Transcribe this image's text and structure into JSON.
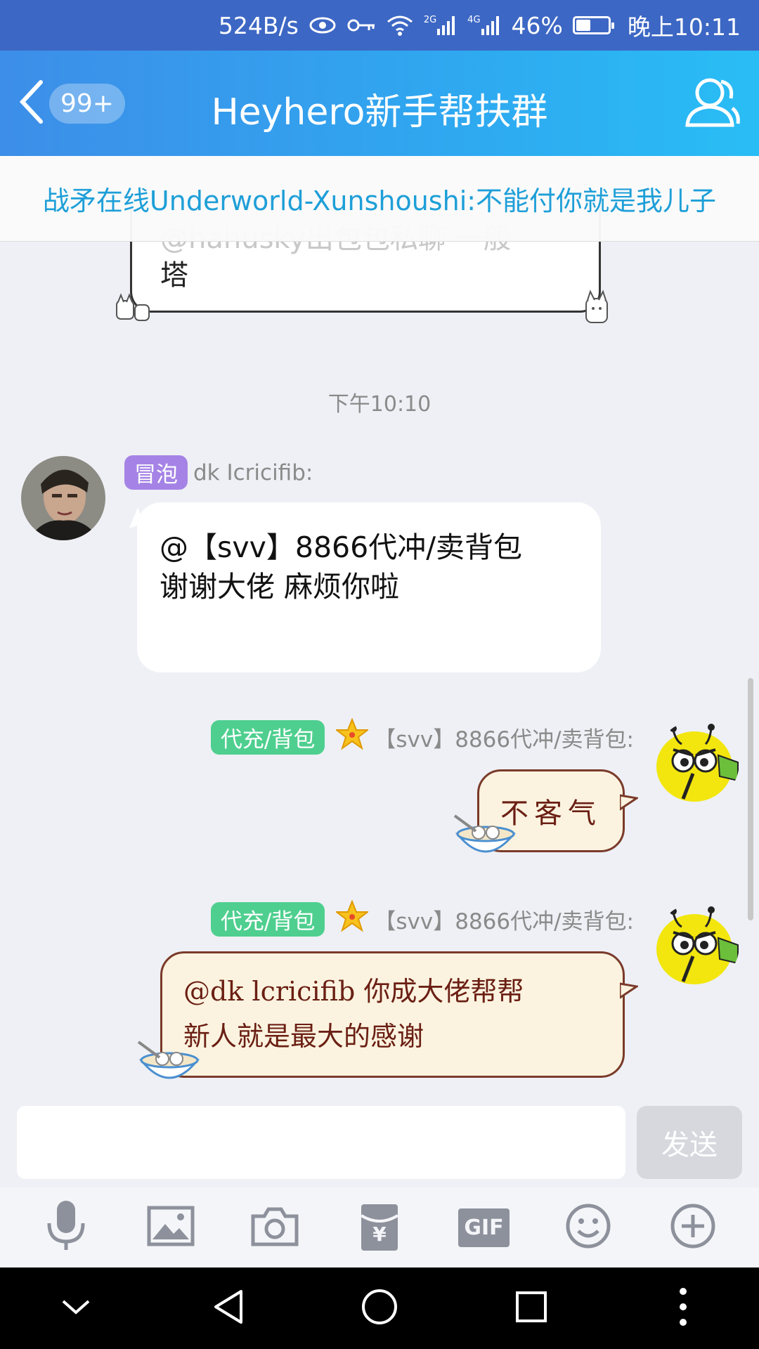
{
  "status_bar": {
    "net_speed": "524B/s",
    "signal_2g": "2G",
    "signal_4g": "4G",
    "battery_pct": "46%",
    "battery_level": 0.46,
    "time": "晚上10:11"
  },
  "header": {
    "unread_badge": "99+",
    "title": "Heyhero新手帮扶群"
  },
  "notice": {
    "text": "战矛在线Underworld-Xunshoushi:不能付你就是我儿子"
  },
  "chat": {
    "prev_message": {
      "faded_line": "@hahusky出包包私聊 一般",
      "last_line": "塔"
    },
    "timestamp": "下午10:10",
    "messages": [
      {
        "tag": "冒泡",
        "sender": "dk Icricifib:",
        "line1": "@【svv】8866代冲/卖背包",
        "line2": "谢谢大佬 麻烦你啦"
      },
      {
        "tag": "代充/背包",
        "sender": "【svv】8866代冲/卖背包:",
        "text": "不客气"
      },
      {
        "tag": "代充/背包",
        "sender": "【svv】8866代冲/卖背包:",
        "line1": "@dk lcricifib 你成大佬帮帮",
        "line2": "新人就是最大的感谢"
      }
    ]
  },
  "input": {
    "placeholder": "",
    "send_label": "发送"
  },
  "toolbar": {
    "gif_label": "GIF",
    "yen_label": "¥"
  },
  "colors": {
    "header_start": "#3d8ee8",
    "header_end": "#29bdf5",
    "notice_text": "#1e9fd8",
    "tag_purple": "#a583e6",
    "tag_green": "#4fcf8f"
  }
}
